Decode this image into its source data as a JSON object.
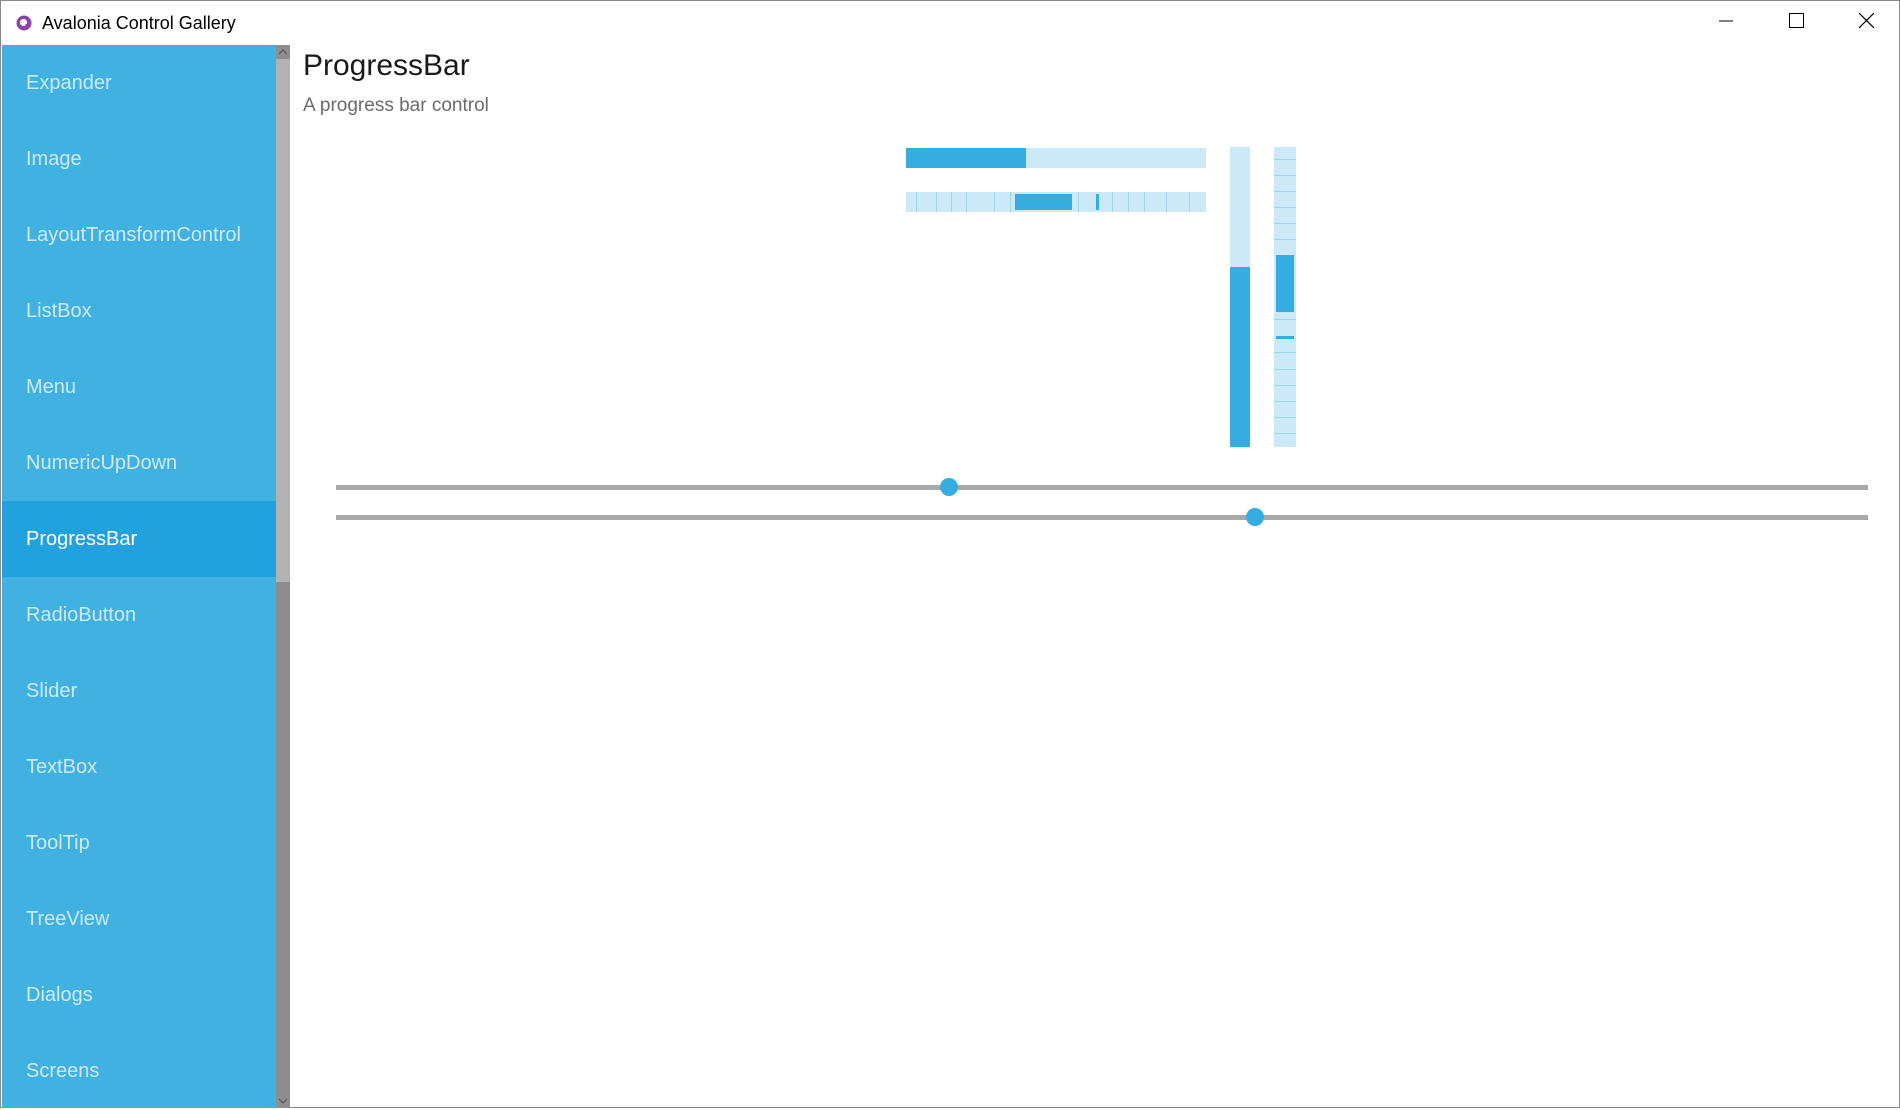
{
  "window": {
    "title": "Avalonia Control Gallery",
    "accent": "#41b1e1",
    "selected_color": "#22a2dc"
  },
  "sidebar": {
    "items": [
      {
        "label": "Expander"
      },
      {
        "label": "Image"
      },
      {
        "label": "LayoutTransformControl"
      },
      {
        "label": "ListBox"
      },
      {
        "label": "Menu"
      },
      {
        "label": "NumericUpDown"
      },
      {
        "label": "ProgressBar",
        "selected": true
      },
      {
        "label": "RadioButton"
      },
      {
        "label": "Slider"
      },
      {
        "label": "TextBox"
      },
      {
        "label": "ToolTip"
      },
      {
        "label": "TreeView"
      },
      {
        "label": "Dialogs"
      },
      {
        "label": "Screens"
      }
    ]
  },
  "page": {
    "title": "ProgressBar",
    "subtitle": "A progress bar control"
  },
  "progress": {
    "horizontal_value": 0.4,
    "vertical_value": 0.6,
    "horizontal_indeterminate": true,
    "vertical_indeterminate": true
  },
  "sliders": [
    {
      "value": 0.4
    },
    {
      "value": 0.6
    }
  ],
  "icons": [
    "avalonia-logo-icon",
    "minimize-icon",
    "maximize-icon",
    "close-icon",
    "chevron-up-icon",
    "chevron-down-icon"
  ]
}
